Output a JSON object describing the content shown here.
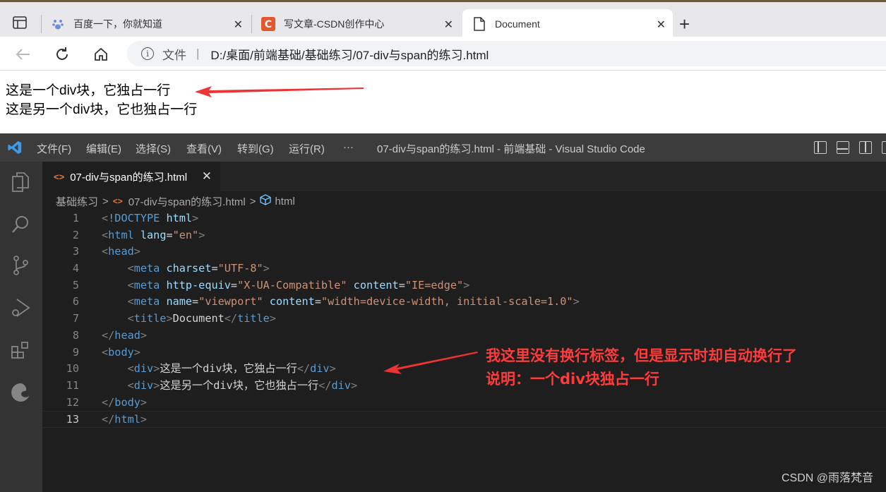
{
  "browser": {
    "tabs": [
      {
        "title": "百度一下，你就知道",
        "icon": "baidu-paw-icon",
        "active": false
      },
      {
        "title": "写文章-CSDN创作中心",
        "icon": "csdn-logo-icon",
        "active": false
      },
      {
        "title": "Document",
        "icon": "document-icon",
        "active": true
      }
    ],
    "close_glyph": "✕",
    "new_tab_glyph": "+",
    "address": {
      "info_glyph": "i",
      "file_label": "文件",
      "separator": "|",
      "url": "D:/桌面/前端基础/基础练习/07-div与span的练习.html"
    },
    "page": {
      "line1": "这是一个div块，它独占一行",
      "line2": "这是另一个div块，它也独占一行"
    }
  },
  "vscode": {
    "menu": [
      "文件(F)",
      "编辑(E)",
      "选择(S)",
      "查看(V)",
      "转到(G)",
      "运行(R)",
      "···"
    ],
    "window_title": "07-div与span的练习.html - 前端基础 - Visual Studio Code",
    "editor_tab": {
      "label": "07-div与span的练习.html",
      "icon_glyph": "<>",
      "close_glyph": "✕"
    },
    "breadcrumb": {
      "folder": "基础练习",
      "sep": ">",
      "file": "07-div与span的练习.html",
      "symbol": "html"
    },
    "code_lines": [
      {
        "n": "1"
      },
      {
        "n": "2"
      },
      {
        "n": "3"
      },
      {
        "n": "4"
      },
      {
        "n": "5"
      },
      {
        "n": "6"
      },
      {
        "n": "7"
      },
      {
        "n": "8"
      },
      {
        "n": "9"
      },
      {
        "n": "10"
      },
      {
        "n": "11"
      },
      {
        "n": "12"
      },
      {
        "n": "13"
      }
    ],
    "code": {
      "doctype": "!DOCTYPE",
      "html_kw": "html",
      "lang_attr": "lang",
      "lang_val": "\"en\"",
      "head": "head",
      "meta": "meta",
      "charset": "charset",
      "charset_val": "\"UTF-8\"",
      "http_equiv": "http-equiv",
      "http_equiv_val": "\"X-UA-Compatible\"",
      "content": "content",
      "content_val1": "\"IE=edge\"",
      "name": "name",
      "name_val": "\"viewport\"",
      "content_val2": "\"width=device-width, initial-scale=1.0\"",
      "title": "title",
      "title_text": "Document",
      "body": "body",
      "div": "div",
      "div1_text": "这是一个div块，它独占一行",
      "div2_text": "这是另一个div块，它也独占一行"
    },
    "annotation": {
      "line1": "我这里没有换行标签，但是显示时却自动换行了",
      "line2": "说明：一个div块独占一行",
      "color": "#ff3b3b"
    },
    "watermark": "CSDN @雨落梵音"
  }
}
